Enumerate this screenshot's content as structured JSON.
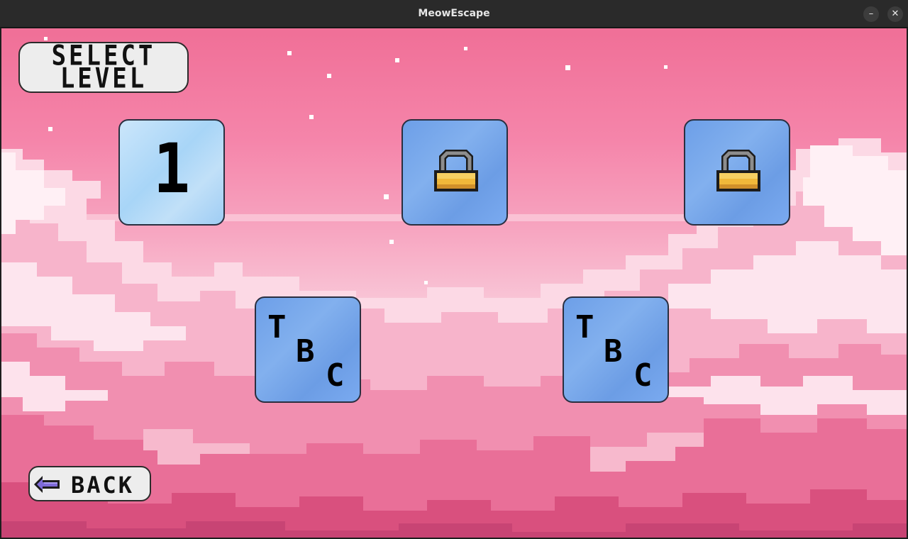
{
  "window": {
    "title": "MeowEscape",
    "minimize_label": "–",
    "close_label": "✕"
  },
  "screen": {
    "heading_line1": "SELECT",
    "heading_line2": "LEVEL",
    "levels": [
      {
        "label": "1",
        "state": "unlocked"
      },
      {
        "label": "",
        "state": "locked",
        "icon": "lock-icon"
      },
      {
        "label": "",
        "state": "locked",
        "icon": "lock-icon"
      },
      {
        "label": "TBC",
        "t": "T",
        "b": "B",
        "c": "C",
        "state": "coming-soon"
      },
      {
        "label": "TBC",
        "t": "T",
        "b": "B",
        "c": "C",
        "state": "coming-soon"
      }
    ],
    "back_label": "BACK",
    "back_icon": "left-arrow-icon"
  },
  "colors": {
    "sky_top": "#f06f97",
    "cloud_light": "#ffe8ef",
    "tile_unlocked": "#a8d5f7",
    "tile_locked": "#6d9fe8",
    "lock_gold": "#f0b83a",
    "arrow_purple": "#7e6ad8"
  }
}
